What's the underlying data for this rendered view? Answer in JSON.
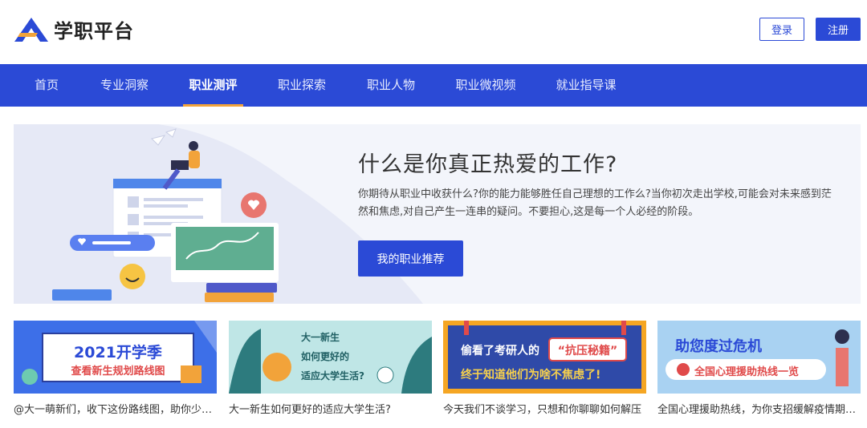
{
  "header": {
    "logo_text": "学职平台",
    "login_label": "登录",
    "register_label": "注册"
  },
  "nav": {
    "items": [
      {
        "label": "首页"
      },
      {
        "label": "专业洞察"
      },
      {
        "label": "职业测评"
      },
      {
        "label": "职业探索"
      },
      {
        "label": "职业人物"
      },
      {
        "label": "职业微视频"
      },
      {
        "label": "就业指导课"
      }
    ],
    "active_index": 2,
    "accent_color": "#2b4ad6",
    "active_underline_color": "#f2a33a"
  },
  "hero": {
    "title": "什么是你真正热爱的工作?",
    "description": "你期待从职业中收获什么?你的能力能够胜任自己理想的工作么?当你初次走出学校,可能会对未来感到茫然和焦虑,对自己产生一连串的疑问。不要担心,这是每一个人必经的阶段。",
    "button_label": "我的职业推荐"
  },
  "cards": [
    {
      "banner_text_1": "2021开学季",
      "banner_text_2": "查看新生规划路线图",
      "caption": "@大一萌新们，收下这份路线图，助你少走弯路"
    },
    {
      "banner_text_1": "大一新生",
      "banner_text_2": "如何更好的",
      "banner_text_3": "适应大学生活?",
      "caption": "大一新生如何更好的适应大学生活?"
    },
    {
      "banner_text_1": "偷看了考研人的",
      "banner_text_2": "“抗压秘籍”",
      "banner_text_3": "终于知道他们为啥不焦虑了!",
      "caption": "今天我们不谈学习，只想和你聊聊如何解压"
    },
    {
      "banner_text_1": "助您度过危机",
      "banner_text_2": "全国心理援助热线一览",
      "caption": "全国心理援助热线，为你支招缓解疫情期间焦虑"
    }
  ]
}
